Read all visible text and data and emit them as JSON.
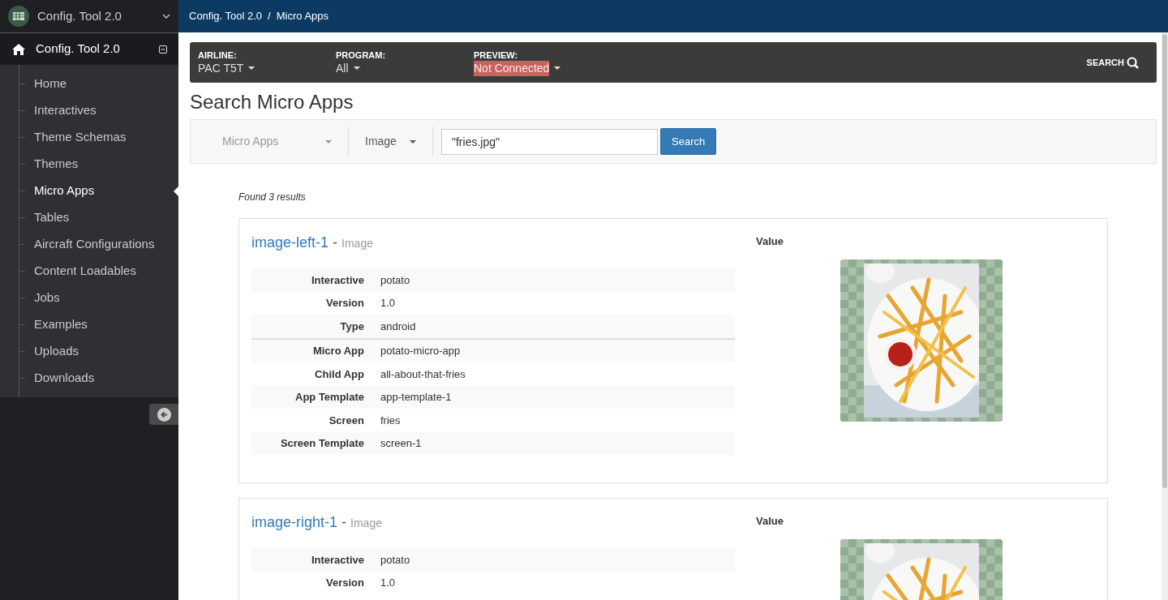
{
  "sidebar": {
    "app_title": "Config. Tool 2.0",
    "section_title": "Config. Tool 2.0",
    "items": [
      {
        "label": "Home",
        "selected": false
      },
      {
        "label": "Interactives",
        "selected": false
      },
      {
        "label": "Theme Schemas",
        "selected": false
      },
      {
        "label": "Themes",
        "selected": false
      },
      {
        "label": "Micro Apps",
        "selected": true
      },
      {
        "label": "Tables",
        "selected": false
      },
      {
        "label": "Aircraft Configurations",
        "selected": false
      },
      {
        "label": "Content Loadables",
        "selected": false
      },
      {
        "label": "Jobs",
        "selected": false
      },
      {
        "label": "Examples",
        "selected": false
      },
      {
        "label": "Uploads",
        "selected": false
      },
      {
        "label": "Downloads",
        "selected": false
      }
    ]
  },
  "breadcrumb": {
    "separator": "/",
    "items": [
      "Config. Tool 2.0",
      "Micro Apps"
    ]
  },
  "title_separator": "-",
  "filter_bar": {
    "fields": [
      {
        "label": "AIRLINE:",
        "value": "PAC T5T",
        "highlighted": false
      },
      {
        "label": "PROGRAM:",
        "value": "All",
        "highlighted": false
      },
      {
        "label": "PREVIEW:",
        "value": "Not Connected",
        "highlighted": true
      }
    ],
    "search_label": "SEARCH"
  },
  "page_title": "Search Micro Apps",
  "search": {
    "dropdowns": [
      {
        "value": "Micro Apps",
        "disabled": true
      },
      {
        "value": "Image",
        "disabled": false
      }
    ],
    "query": "\"fries.jpg\"",
    "button": "Search"
  },
  "results_summary": "Found 3 results",
  "results": [
    {
      "name": "image-left-1",
      "type": "Image",
      "value_label": "Value",
      "image": {
        "kind": "picture"
      },
      "groups": [
        [
          {
            "label": "Interactive",
            "value": "potato"
          },
          {
            "label": "Version",
            "value": "1.0"
          },
          {
            "label": "Type",
            "value": "android"
          }
        ],
        [
          {
            "label": "Micro App",
            "value": "potato-micro-app"
          },
          {
            "label": "Child App",
            "value": "all-about-that-fries"
          },
          {
            "label": "App Template",
            "value": "app-template-1"
          },
          {
            "label": "Screen",
            "value": "fries"
          },
          {
            "label": "Screen Template",
            "value": "screen-1"
          }
        ]
      ]
    },
    {
      "name": "image-right-1",
      "type": "Image",
      "value_label": "Value",
      "image": {
        "kind": "picture"
      },
      "groups": [
        [
          {
            "label": "Interactive",
            "value": "potato"
          },
          {
            "label": "Version",
            "value": "1.0"
          }
        ]
      ]
    }
  ]
}
